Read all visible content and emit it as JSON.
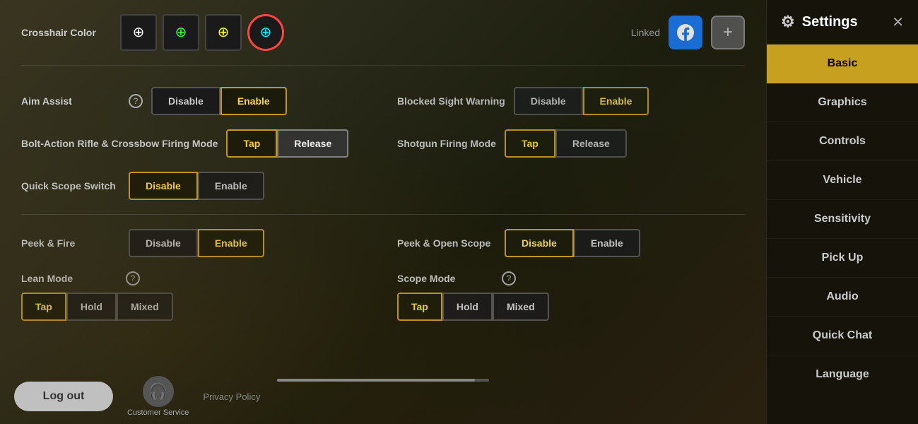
{
  "sidebar": {
    "title": "Settings",
    "nav_items": [
      {
        "id": "basic",
        "label": "Basic",
        "active": true
      },
      {
        "id": "graphics",
        "label": "Graphics",
        "active": false
      },
      {
        "id": "controls",
        "label": "Controls",
        "active": false
      },
      {
        "id": "vehicle",
        "label": "Vehicle",
        "active": false
      },
      {
        "id": "sensitivity",
        "label": "Sensitivity",
        "active": false
      },
      {
        "id": "pickup",
        "label": "Pick Up",
        "active": false
      },
      {
        "id": "audio",
        "label": "Audio",
        "active": false
      },
      {
        "id": "quickchat",
        "label": "Quick Chat",
        "active": false
      },
      {
        "id": "language",
        "label": "Language",
        "active": false
      }
    ]
  },
  "crosshair": {
    "label": "Crosshair Color",
    "linked_label": "Linked",
    "colors": [
      "white",
      "green",
      "yellow",
      "cyan"
    ],
    "selected_index": 3
  },
  "settings": {
    "aim_assist": {
      "label": "Aim Assist",
      "disable": "Disable",
      "enable": "Enable",
      "active": "enable"
    },
    "blocked_sight": {
      "label": "Blocked Sight Warning",
      "disable": "Disable",
      "enable": "Enable",
      "active": "enable"
    },
    "bolt_action": {
      "label": "Bolt-Action Rifle & Crossbow Firing Mode",
      "tap": "Tap",
      "release": "Release",
      "active": "release"
    },
    "shotgun_firing": {
      "label": "Shotgun Firing Mode",
      "tap": "Tap",
      "release": "Release",
      "active": "tap"
    },
    "quick_scope": {
      "label": "Quick Scope Switch",
      "disable": "Disable",
      "enable": "Enable",
      "active": "disable"
    }
  },
  "bottom_settings": {
    "peek_fire": {
      "label": "Peek & Fire",
      "disable": "Disable",
      "enable": "Enable",
      "active": "enable"
    },
    "peek_open_scope": {
      "label": "Peek & Open Scope",
      "disable": "Disable",
      "enable": "Enable",
      "active": "disable"
    },
    "lean_mode": {
      "label": "Lean Mode",
      "tap": "Tap",
      "hold": "Hold",
      "mixed": "Mixed",
      "active": "tap"
    },
    "scope_mode": {
      "label": "Scope Mode",
      "tap": "Tap",
      "hold": "Hold",
      "mixed": "Mixed",
      "active": "tap"
    }
  },
  "footer": {
    "logout": "Log out",
    "customer_service": "Customer Service",
    "privacy_policy": "Privacy Policy"
  }
}
